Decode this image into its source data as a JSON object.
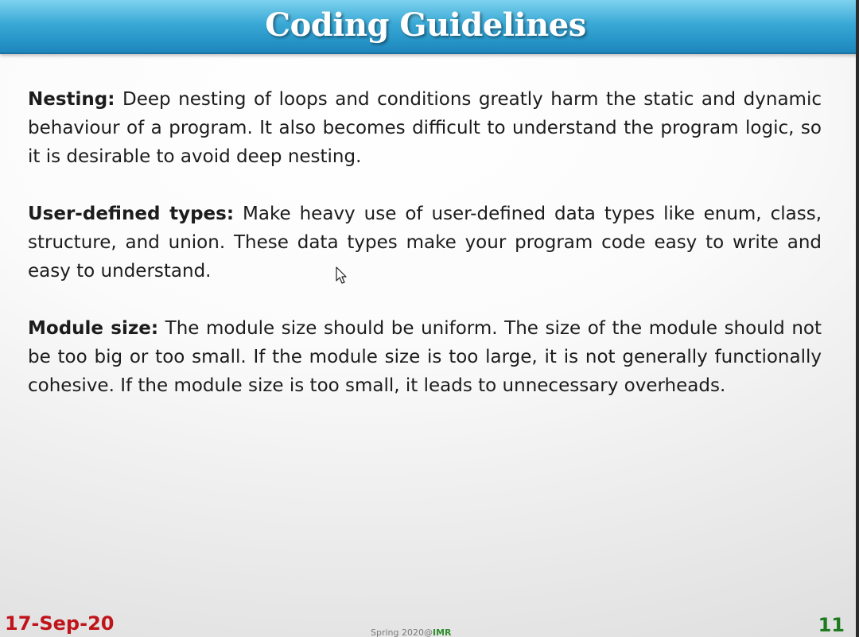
{
  "slide": {
    "title": "Coding Guidelines",
    "paragraphs": [
      {
        "term": "Nesting:",
        "text": "Deep nesting of loops and conditions greatly harm the static and dynamic behaviour of a program. It also becomes difficult to understand the program logic, so it is desirable to avoid deep nesting."
      },
      {
        "term": "User-defined types:",
        "text": "Make heavy use of user-defined data types like enum, class, structure, and union. These data types make your program code easy to write and easy to understand."
      },
      {
        "term": "Module size:",
        "text": "The module size should be uniform. The size of the module should not be too big or too small. If the module size is too large, it is not generally functionally cohesive. If the module size is too small, it leads to unnecessary overheads."
      }
    ]
  },
  "footer": {
    "date": "17-Sep-20",
    "center_text": "Spring 2020@",
    "center_brand": "IMR",
    "page_number": "11"
  },
  "colors": {
    "header_blue": "#2593c6",
    "date_red": "#c0141b",
    "page_green": "#1e7a1e"
  },
  "icons": {
    "cursor": "mouse-pointer-icon"
  }
}
